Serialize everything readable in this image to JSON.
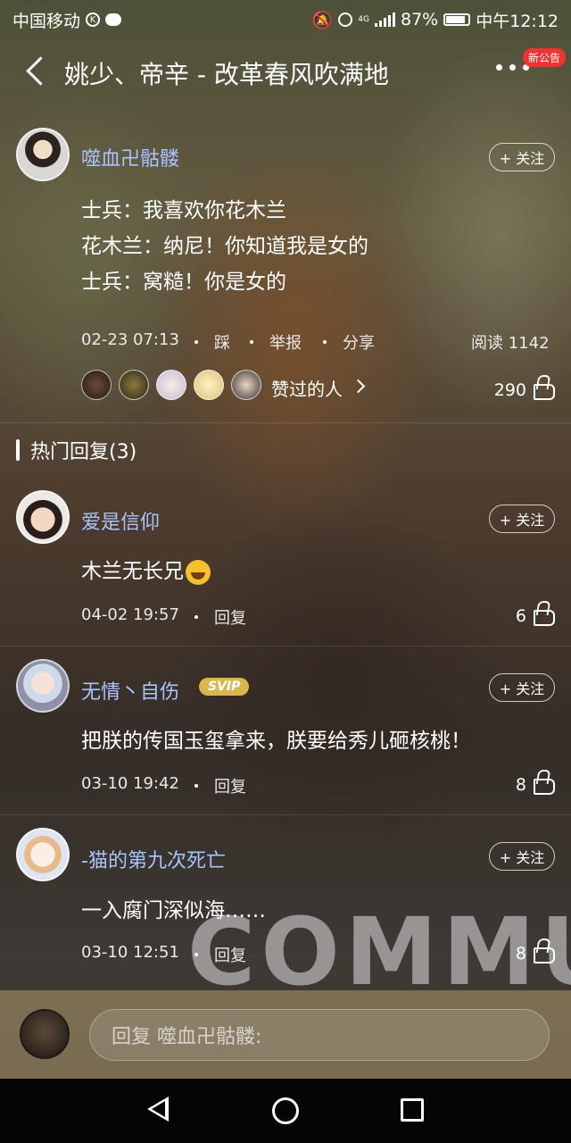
{
  "status_bar": {
    "carrier": "中国移动",
    "battery": "87%",
    "time": "中午12:12",
    "network": "4G"
  },
  "header": {
    "back_icon": "chevron-left-icon",
    "title": "姚少、帝辛 - 改革春风吹满地",
    "more_icon": "more-dots-icon",
    "notice_badge": "新公告"
  },
  "post": {
    "author": "噬血卍骷髅",
    "follow_label": "+ 关注",
    "lines": [
      "士兵：我喜欢你花木兰",
      "花木兰：纳尼！你知道我是女的",
      "士兵：窝糙！你是女的"
    ],
    "time": "02-23 07:13",
    "actions": [
      "踩",
      "举报",
      "分享"
    ],
    "views": "阅读 1142",
    "likers_label": "赞过的人",
    "likes": "290"
  },
  "hot_replies": {
    "label": "热门回复(3)"
  },
  "comments": [
    {
      "name": "爱是信仰",
      "text": "木兰无长兄",
      "emoji": "laughing-face-icon",
      "time": "04-02 19:57",
      "reply": "回复",
      "likes": "6",
      "follow": "+ 关注"
    },
    {
      "name": "无情丶自伤",
      "badge": "SVIP",
      "text": "把朕的传国玉玺拿来，朕要给秀儿砸核桃！",
      "time": "03-10 19:42",
      "reply": "回复",
      "likes": "8",
      "follow": "+ 关注"
    },
    {
      "name": "-猫的第九次死亡",
      "text": "一入腐门深似海……",
      "time": "03-10 12:51",
      "reply": "回复",
      "likes": "8",
      "follow": "+ 关注"
    }
  ],
  "background_text": "COMMUN",
  "reply_box": {
    "placeholder": "回复 噬血卍骷髅:"
  },
  "nav": {
    "back": "nav-back-icon",
    "home": "nav-home-icon",
    "recent": "nav-recent-icon"
  }
}
